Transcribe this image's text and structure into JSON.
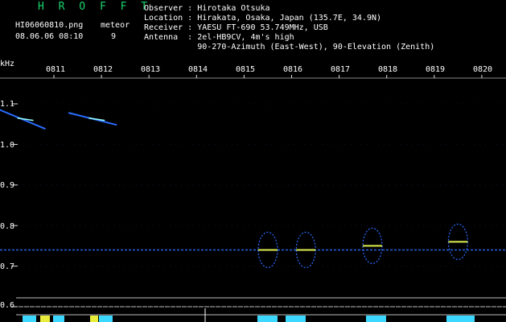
{
  "header": {
    "app_title": "H R O F F T",
    "filename": "HI06060810.png",
    "meteor_label": "meteor",
    "datetime": "08.06.06 08:10",
    "meteor_count": "9",
    "info_lines": [
      "Observer : Hirotaka Otsuka",
      "Location : Hirakata, Osaka, Japan (135.7E, 34.9N)",
      "Receiver : YAESU FT-690 53.749MHz, USB",
      "Antenna  : 2el-HB9CV, 4m's high",
      "           90-270-Azimuth (East-West), 90-Elevation (Zenith)"
    ]
  },
  "chart_data": {
    "type": "heatmap",
    "ylabel_unit": "kHz",
    "x_ticks": [
      "0811",
      "0812",
      "0813",
      "0814",
      "0815",
      "0816",
      "0817",
      "0818",
      "0819",
      "0820"
    ],
    "y_ticks": [
      "1.1",
      "1.0",
      "0.9",
      "0.8",
      "0.7",
      "0.6"
    ],
    "ylim": [
      0.6,
      1.1
    ],
    "carrier_khz": 0.74,
    "meteor_echoes": [
      {
        "time": "0810.4",
        "freq_start": 1.08,
        "freq_end": 1.05
      },
      {
        "time": "0811.9",
        "freq_start": 1.07,
        "freq_end": 1.06
      },
      {
        "time": "0815.5",
        "freq": 0.74
      },
      {
        "time": "0816.3",
        "freq": 0.74
      },
      {
        "time": "0817.7",
        "freq": 0.75
      },
      {
        "time": "0819.5",
        "freq": 0.76
      }
    ],
    "colors": {
      "background": "#000000",
      "signal": "#2a6cff",
      "strong": "#e0f050",
      "title": "#19d36b"
    }
  }
}
